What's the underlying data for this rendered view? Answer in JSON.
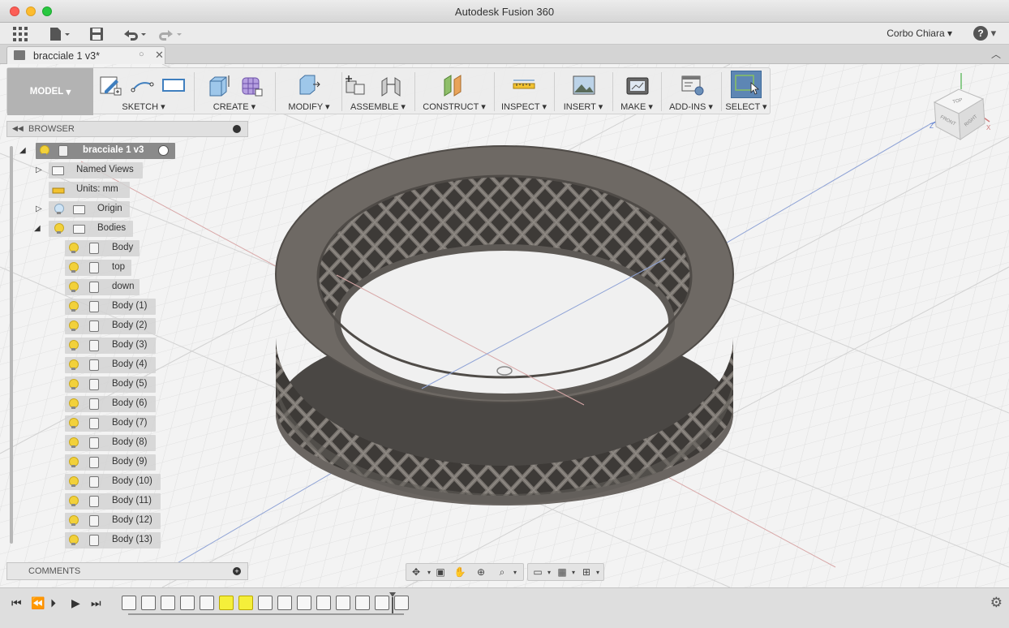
{
  "window": {
    "title": "Autodesk Fusion 360"
  },
  "quick_access": {
    "user_name": "Corbo Chiara",
    "help_label": "?"
  },
  "document_tab": {
    "title": "bracciale 1 v3*"
  },
  "workspace": {
    "label": "MODEL"
  },
  "ribbon_groups": [
    {
      "id": "sketch",
      "label": "SKETCH"
    },
    {
      "id": "create",
      "label": "CREATE"
    },
    {
      "id": "modify",
      "label": "MODIFY"
    },
    {
      "id": "assemble",
      "label": "ASSEMBLE"
    },
    {
      "id": "construct",
      "label": "CONSTRUCT"
    },
    {
      "id": "inspect",
      "label": "INSPECT"
    },
    {
      "id": "insert",
      "label": "INSERT"
    },
    {
      "id": "make",
      "label": "MAKE"
    },
    {
      "id": "addins",
      "label": "ADD-INS"
    },
    {
      "id": "select",
      "label": "SELECT"
    }
  ],
  "browser": {
    "title": "BROWSER",
    "root": "bracciale 1 v3",
    "named_views": "Named Views",
    "units": "Units: mm",
    "origin": "Origin",
    "bodies": "Bodies",
    "body_items": [
      "Body",
      "top",
      "down",
      "Body (1)",
      "Body (2)",
      "Body (3)",
      "Body (4)",
      "Body (5)",
      "Body (6)",
      "Body (7)",
      "Body (8)",
      "Body (9)",
      "Body (10)",
      "Body (11)",
      "Body (12)",
      "Body (13)"
    ]
  },
  "comments": {
    "title": "COMMENTS"
  },
  "viewcube": {
    "top": "TOP",
    "front": "FRONT",
    "right": "RIGHT"
  },
  "colors": {
    "accent": "#3f7fbf",
    "highlight": "#f5ef3a",
    "model": "#5e5a56",
    "workspace_button": "#b3b3b3"
  }
}
